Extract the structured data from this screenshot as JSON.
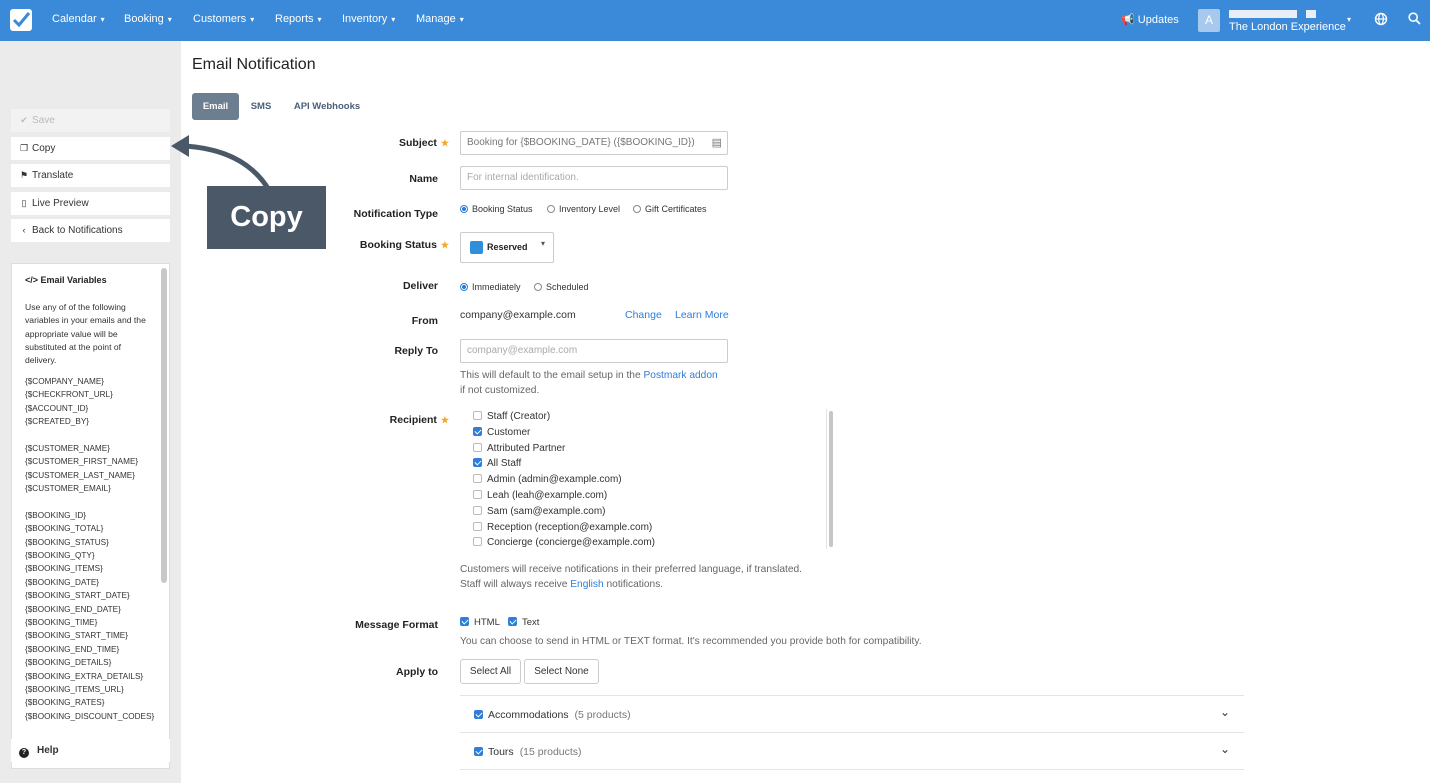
{
  "nav": {
    "items": [
      {
        "label": "Calendar"
      },
      {
        "label": "Booking"
      },
      {
        "label": "Customers"
      },
      {
        "label": "Reports"
      },
      {
        "label": "Inventory"
      },
      {
        "label": "Manage"
      }
    ],
    "updates": "Updates",
    "avatar_letter": "A",
    "company": "The London Experience"
  },
  "sidebar": {
    "save": "Save",
    "copy": "Copy",
    "translate": "Translate",
    "live_preview": "Live Preview",
    "back": "Back to Notifications",
    "help": "Help",
    "vars_title": "Email Variables",
    "vars_desc": "Use any of of the following variables in your emails and the appropriate value will be substituted at the point of delivery.",
    "vars": [
      "{$COMPANY_NAME}",
      "{$CHECKFRONT_URL}",
      "{$ACCOUNT_ID}",
      "{$CREATED_BY}",
      "",
      "{$CUSTOMER_NAME}",
      "{$CUSTOMER_FIRST_NAME}",
      "{$CUSTOMER_LAST_NAME}",
      "{$CUSTOMER_EMAIL}",
      "",
      "{$BOOKING_ID}",
      "{$BOOKING_TOTAL}",
      "{$BOOKING_STATUS}",
      "{$BOOKING_QTY}",
      "{$BOOKING_ITEMS}",
      "{$BOOKING_DATE}",
      "{$BOOKING_START_DATE}",
      "{$BOOKING_END_DATE}",
      "{$BOOKING_TIME}",
      "{$BOOKING_START_TIME}",
      "{$BOOKING_END_TIME}",
      "{$BOOKING_DETAILS}",
      "{$BOOKING_EXTRA_DETAILS}",
      "{$BOOKING_ITEMS_URL}",
      "{$BOOKING_RATES}",
      "{$BOOKING_DISCOUNT_CODES}"
    ]
  },
  "page": {
    "title": "Email Notification",
    "tabs": [
      "Email",
      "SMS",
      "API Webhooks"
    ]
  },
  "form": {
    "subject_label": "Subject",
    "subject_value": "Booking for {$BOOKING_DATE} ({$BOOKING_ID})",
    "name_label": "Name",
    "name_placeholder": "For internal identification.",
    "type_label": "Notification Type",
    "type_options": [
      "Booking Status",
      "Inventory Level",
      "Gift Certificates"
    ],
    "status_label": "Booking Status",
    "status_value": "Reserved",
    "status_color": "#2f8fd8",
    "deliver_label": "Deliver",
    "deliver_options": [
      "Immediately",
      "Scheduled"
    ],
    "from_label": "From",
    "from_value": "company@example.com",
    "from_change": "Change",
    "from_learn": "Learn More",
    "reply_label": "Reply To",
    "reply_placeholder": "company@example.com",
    "reply_help_1": "This will default to the email setup in the",
    "reply_help_link": "Postmark addon",
    "reply_help_2": "if not customized.",
    "recipient_label": "Recipient",
    "recipients": [
      {
        "label": "Staff (Creator)",
        "checked": false
      },
      {
        "label": "Customer",
        "checked": true
      },
      {
        "label": "Attributed Partner",
        "checked": false
      },
      {
        "label": "All Staff",
        "checked": true
      },
      {
        "label": "Admin (admin@example.com)",
        "checked": false
      },
      {
        "label": "Leah (leah@example.com)",
        "checked": false
      },
      {
        "label": "Sam (sam@example.com)",
        "checked": false
      },
      {
        "label": "Reception (reception@example.com)",
        "checked": false
      },
      {
        "label": "Concierge (concierge@example.com)",
        "checked": false
      }
    ],
    "recip_help_1": "Customers will receive notifications in their preferred language, if translated.",
    "recip_help_2a": "Staff will always receive",
    "recip_help_link": "English",
    "recip_help_2b": "notifications.",
    "format_label": "Message Format",
    "format_html": "HTML",
    "format_text": "Text",
    "format_help": "You can choose to send in HTML or TEXT format. It's recommended you provide both for compatibility.",
    "apply_label": "Apply to",
    "select_all": "Select All",
    "select_none": "Select None",
    "categories": [
      {
        "name": "Accommodations",
        "count": "(5 products)"
      },
      {
        "name": "Tours",
        "count": "(15 products)"
      }
    ]
  },
  "callout": {
    "text": "Copy"
  },
  "colors": {
    "nav": "#3a8ad9",
    "accent": "#2f7ed8",
    "callout": "#4a5868"
  }
}
